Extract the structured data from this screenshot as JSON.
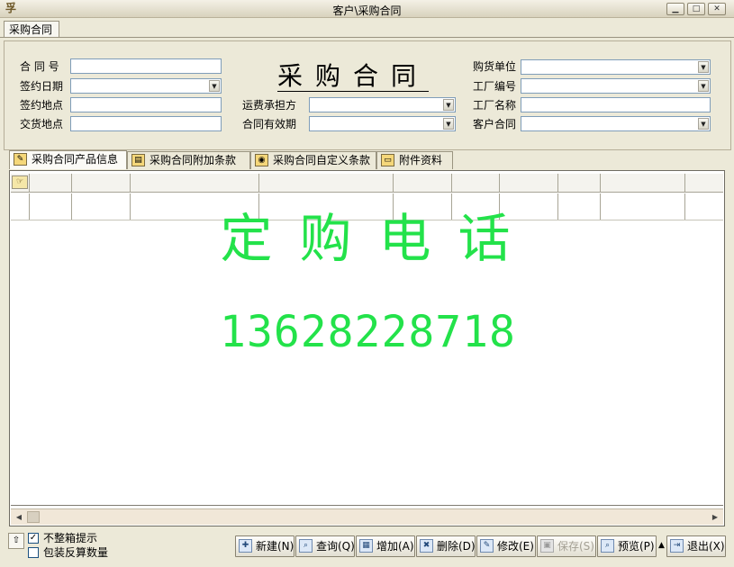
{
  "window": {
    "title": "客户\\采购合同",
    "controls": {
      "minimize": "▁",
      "maximize": "□",
      "close": "✕"
    }
  },
  "doc_tab": "采购合同",
  "header": {
    "heading": "采购合同",
    "fields": {
      "contract_no": {
        "label": "合 同 号",
        "value": ""
      },
      "sign_date": {
        "label": "签约日期",
        "value": ""
      },
      "sign_place": {
        "label": "签约地点",
        "value": ""
      },
      "delivery_place": {
        "label": "交货地点",
        "value": ""
      },
      "freight_payer": {
        "label": "运费承担方",
        "value": ""
      },
      "valid_period": {
        "label": "合同有效期",
        "value": ""
      },
      "buyer": {
        "label": "购货单位",
        "value": ""
      },
      "factory_code": {
        "label": "工厂编号",
        "value": ""
      },
      "factory_name": {
        "label": "工厂名称",
        "value": ""
      },
      "customer_contract": {
        "label": "客户合同",
        "value": ""
      }
    }
  },
  "tabs": [
    {
      "label": "采购合同产品信息",
      "active": true
    },
    {
      "label": "采购合同附加条款",
      "active": false
    },
    {
      "label": "采购合同自定义条款",
      "active": false
    },
    {
      "label": "附件资料",
      "active": false
    }
  ],
  "grid": {
    "columns": [
      "",
      "",
      "",
      "",
      "",
      "",
      "",
      "",
      "",
      "",
      ""
    ],
    "rows": [
      [
        "",
        "",
        "",
        "",
        "",
        "",
        "",
        "",
        "",
        "",
        ""
      ]
    ]
  },
  "overlay": {
    "line1": "定购电话",
    "line2": "13628228718",
    "color": "#23e24a"
  },
  "options": [
    {
      "label": "不整箱提示",
      "checked": true
    },
    {
      "label": "包装反算数量",
      "checked": false
    }
  ],
  "toolbar": {
    "new": "新建(N)",
    "query": "查询(Q)",
    "add": "增加(A)",
    "delete": "删除(D)",
    "edit": "修改(E)",
    "save": "保存(S)",
    "preview": "预览(P)",
    "exit": "退出(X)"
  }
}
